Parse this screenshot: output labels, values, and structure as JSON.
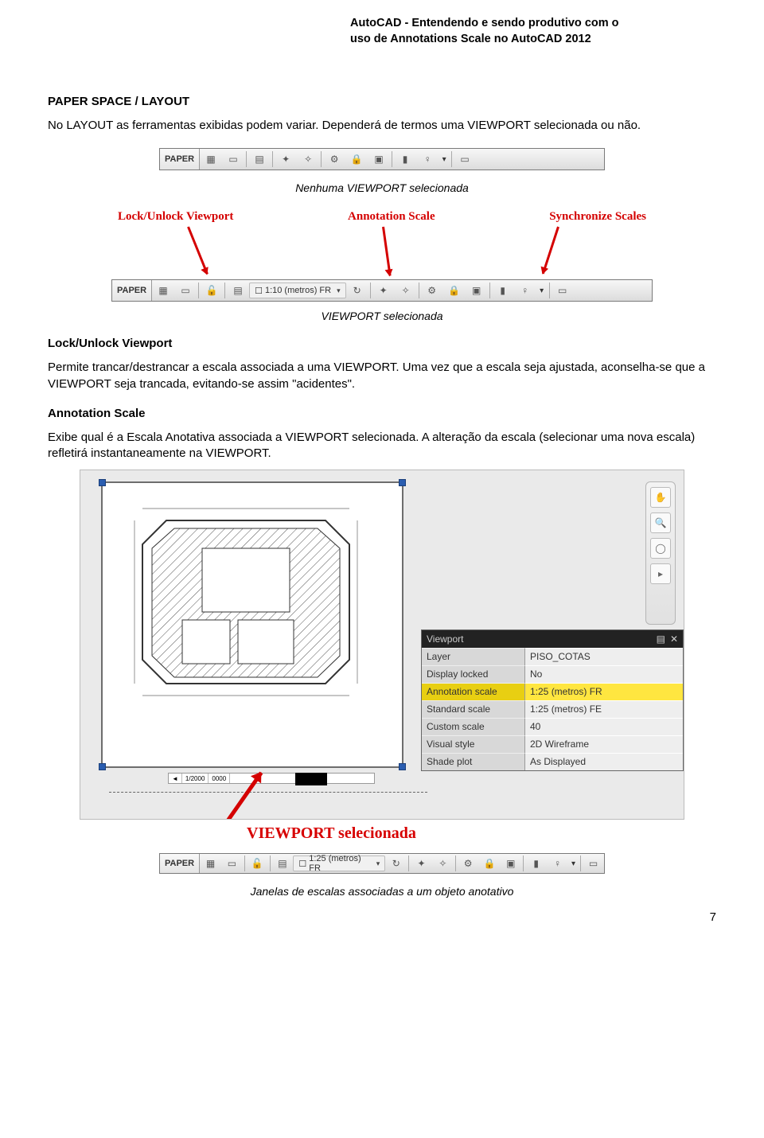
{
  "header": {
    "line1": "AutoCAD - Entendendo e sendo produtivo com o",
    "line2": "uso de Annotations Scale no AutoCAD 2012"
  },
  "section_title": "PAPER SPACE / LAYOUT",
  "intro_para": "No LAYOUT as ferramentas exibidas podem variar. Dependerá de termos uma VIEWPORT selecionada ou não.",
  "toolbar1": {
    "paper_label": "PAPER"
  },
  "caption_no_vp": "Nenhuma VIEWPORT selecionada",
  "callouts": {
    "lock": "Lock/Unlock Viewport",
    "anno": "Annotation Scale",
    "sync": "Synchronize Scales"
  },
  "toolbar2": {
    "paper_label": "PAPER",
    "scale_value": "1:10 (metros) FR"
  },
  "caption_vp_sel": "VIEWPORT selecionada",
  "h_lock": "Lock/Unlock Viewport",
  "p_lock": "Permite trancar/destrancar a escala associada a uma VIEWPORT. Uma vez que a escala seja ajustada, aconselha-se que a VIEWPORT seja trancada, evitando-se assim \"acidentes\".",
  "h_anno": "Annotation Scale",
  "p_anno": "Exibe qual é a Escala Anotativa associada a VIEWPORT selecionada. A alteração da escala (selecionar uma nova escala) refletirá instantaneamente na VIEWPORT.",
  "prop": {
    "title": "Viewport",
    "rows": [
      {
        "k": "Layer",
        "v": "PISO_COTAS"
      },
      {
        "k": "Display locked",
        "v": "No"
      },
      {
        "k": "Annotation scale",
        "v": "1:25 (metros) FR",
        "hl": true
      },
      {
        "k": "Standard scale",
        "v": "1:25 (metros) FE"
      },
      {
        "k": "Custom scale",
        "v": "40"
      },
      {
        "k": "Visual style",
        "v": "2D Wireframe"
      },
      {
        "k": "Shade plot",
        "v": "As Displayed"
      }
    ]
  },
  "model_tab": {
    "a": "◄",
    "b": "1/2000",
    "c": "0000"
  },
  "vp_sel_red": "VIEWPORT selecionada",
  "toolbar3": {
    "paper_label": "PAPER",
    "scale_value": "1:25 (metros) FR"
  },
  "final_caption": "Janelas de escalas associadas a um objeto anotativo",
  "page_num": "7"
}
